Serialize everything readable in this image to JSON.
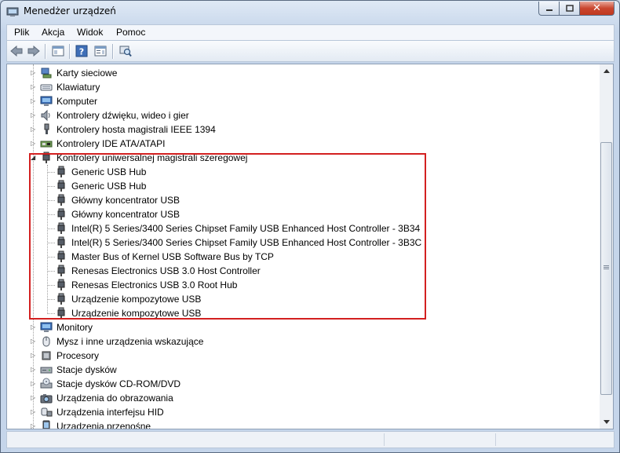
{
  "window": {
    "title": "Menedżer urządzeń",
    "close_glyph": "✕"
  },
  "menu": [
    "Plik",
    "Akcja",
    "Widok",
    "Pomoc"
  ],
  "toolbar": {
    "icons": [
      "back-arrow-icon",
      "forward-arrow-icon",
      "show-hide-console-tree-icon",
      "help-icon",
      "properties-icon",
      "scan-hardware-icon"
    ]
  },
  "tree": {
    "top_categories": [
      {
        "label": "Karty sieciowe",
        "icon": "network-adapter-icon"
      },
      {
        "label": "Klawiatury",
        "icon": "keyboard-icon"
      },
      {
        "label": "Komputer",
        "icon": "computer-icon"
      },
      {
        "label": "Kontrolery dźwięku, wideo i gier",
        "icon": "speaker-icon"
      },
      {
        "label": "Kontrolery hosta magistrali IEEE 1394",
        "icon": "ieee1394-icon"
      },
      {
        "label": "Kontrolery IDE ATA/ATAPI",
        "icon": "ide-controller-icon"
      }
    ],
    "expanded_category": {
      "label": "Kontrolery uniwersalnej magistrali szeregowej",
      "icon": "usb-plug-icon",
      "children": [
        "Generic USB Hub",
        "Generic USB Hub",
        "Główny koncentrator USB",
        "Główny koncentrator USB",
        "Intel(R) 5 Series/3400 Series Chipset Family USB Enhanced Host Controller - 3B34",
        "Intel(R) 5 Series/3400 Series Chipset Family USB Enhanced Host Controller - 3B3C",
        "Master Bus of Kernel USB Software Bus by TCP",
        "Renesas Electronics USB 3.0 Host Controller",
        "Renesas Electronics USB 3.0 Root Hub",
        "Urządzenie kompozytowe USB",
        "Urządzenie kompozytowe USB"
      ]
    },
    "bottom_categories": [
      {
        "label": "Monitory",
        "icon": "monitor-icon"
      },
      {
        "label": "Mysz i inne urządzenia wskazujące",
        "icon": "mouse-icon"
      },
      {
        "label": "Procesory",
        "icon": "processor-icon"
      },
      {
        "label": "Stacje dysków",
        "icon": "disk-drive-icon"
      },
      {
        "label": "Stacje dysków CD-ROM/DVD",
        "icon": "cdrom-icon"
      },
      {
        "label": "Urządzenia do obrazowania",
        "icon": "camera-icon"
      },
      {
        "label": "Urządzenia interfejsu HID",
        "icon": "hid-icon"
      },
      {
        "label": "Urządzenia przenośne",
        "icon": "portable-device-icon"
      }
    ]
  },
  "colors": {
    "highlight_border": "#d32020"
  }
}
